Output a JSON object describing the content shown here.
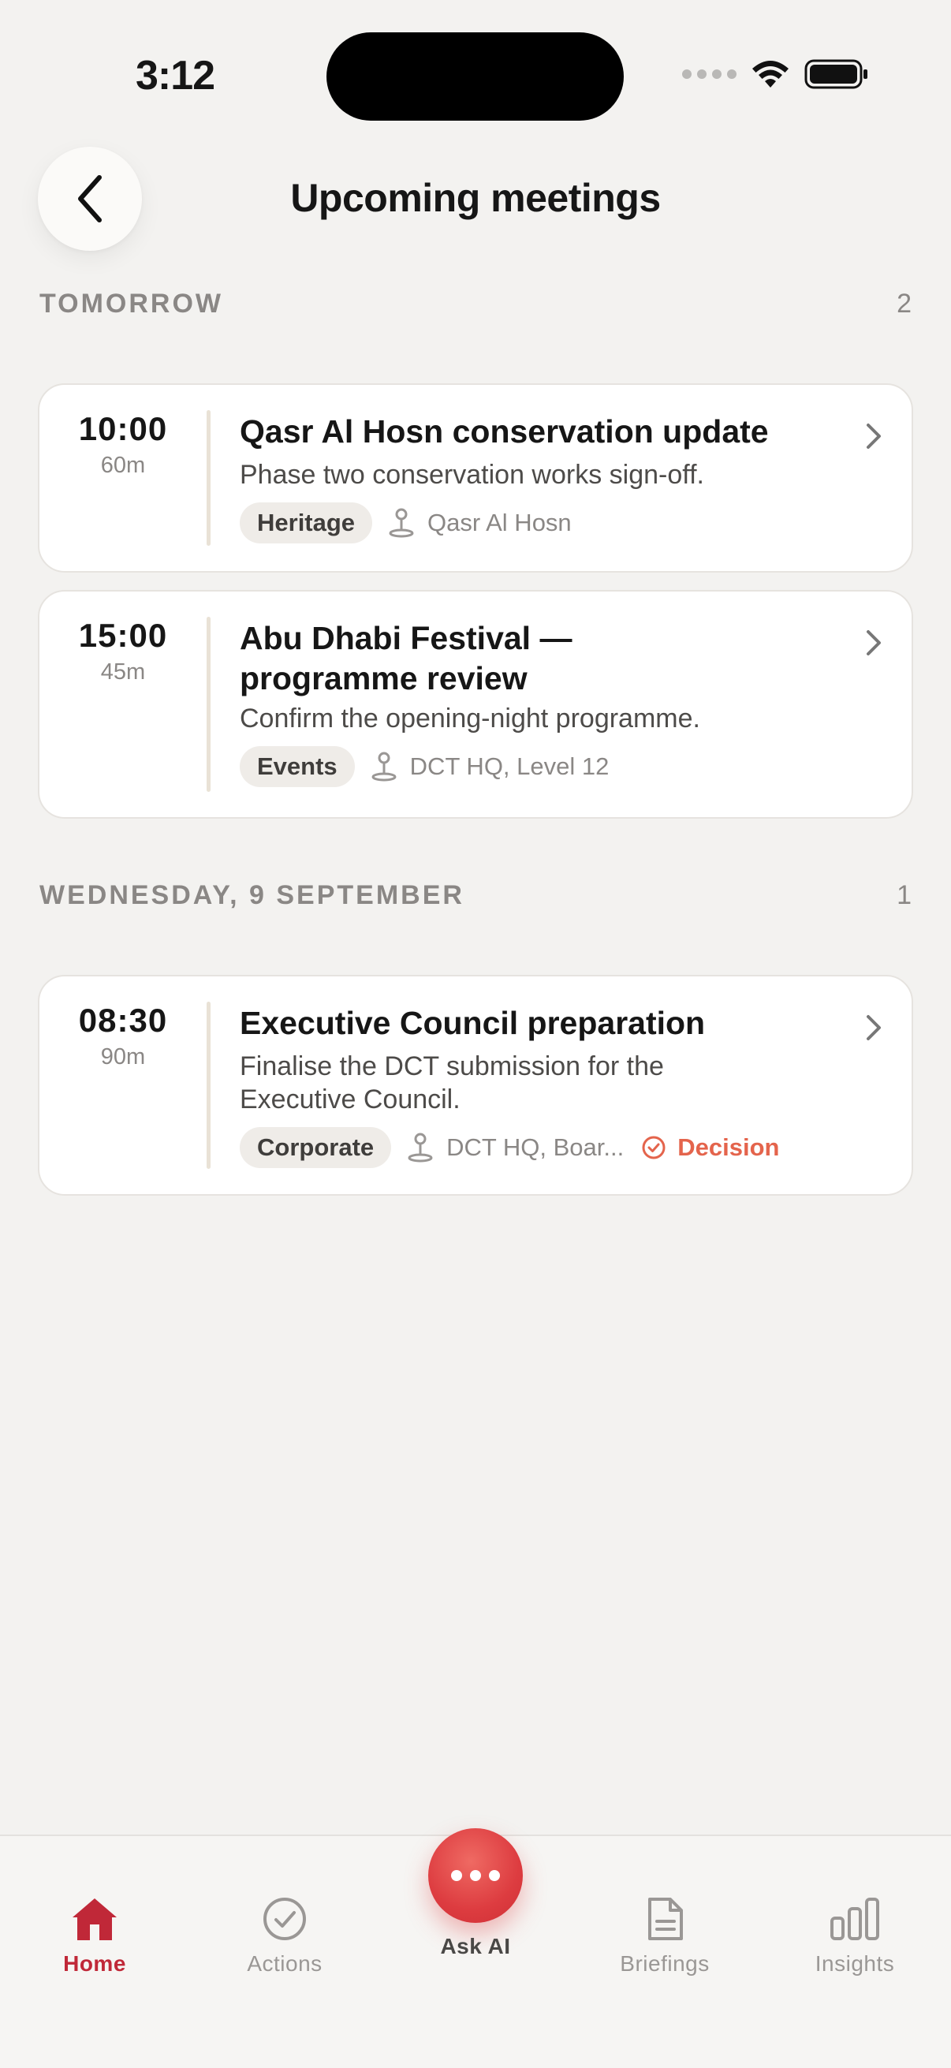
{
  "status_bar": {
    "time": "3:12"
  },
  "header": {
    "title": "Upcoming meetings"
  },
  "sections": [
    {
      "label": "TOMORROW",
      "count": "2",
      "meetings": [
        {
          "time": "10:00",
          "duration": "60m",
          "title": "Qasr Al Hosn conservation update",
          "description": "Phase two conservation works sign-off.",
          "tag": "Heritage",
          "location": "Qasr Al Hosn"
        },
        {
          "time": "15:00",
          "duration": "45m",
          "title": "Abu Dhabi Festival — programme review",
          "description": "Confirm the opening-night programme.",
          "tag": "Events",
          "location": "DCT HQ, Level 12"
        }
      ]
    },
    {
      "label": "WEDNESDAY, 9 SEPTEMBER",
      "count": "1",
      "meetings": [
        {
          "time": "08:30",
          "duration": "90m",
          "title": "Executive Council preparation",
          "description": "Finalise the DCT submission for the Executive Council.",
          "tag": "Corporate",
          "location": "DCT HQ, Boar...",
          "badge": "Decision"
        }
      ]
    }
  ],
  "tabbar": {
    "items": [
      {
        "label": "Home",
        "icon": "home-icon",
        "active": true
      },
      {
        "label": "Actions",
        "icon": "check-circle-icon"
      },
      {
        "label": "Ask AI",
        "icon": "more-dots-icon"
      },
      {
        "label": "Briefings",
        "icon": "document-icon"
      },
      {
        "label": "Insights",
        "icon": "bar-chart-icon"
      }
    ]
  },
  "colors": {
    "background": "#f3f2f0",
    "accent": "#c02838",
    "fab": "#dd3c40",
    "decision": "#e4644c"
  }
}
